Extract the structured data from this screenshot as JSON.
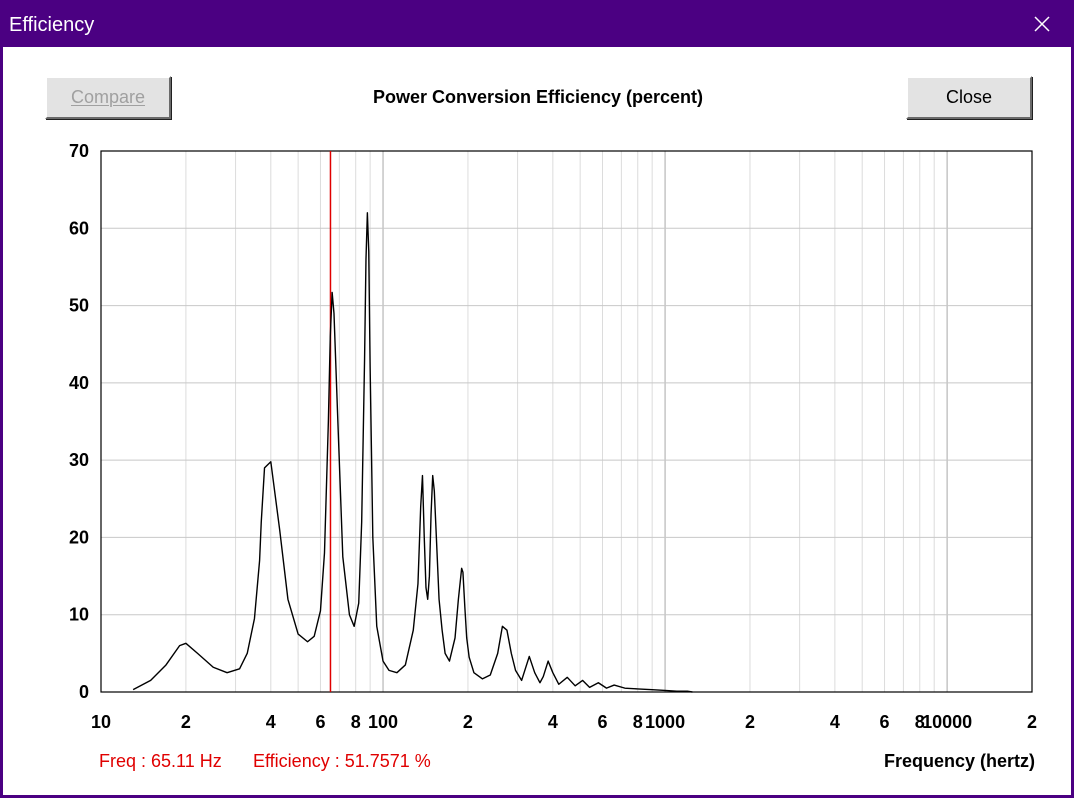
{
  "window": {
    "title": "Efficiency",
    "close_icon": "close-icon"
  },
  "toolbar": {
    "compare_label": "Compare",
    "close_label": "Close"
  },
  "readouts": {
    "freq": "Freq : 65.11 Hz",
    "efficiency": "Efficiency : 51.7571 %"
  },
  "colors": {
    "titlebar": "#4b0082",
    "curve": "#000000",
    "cursor": "#e00000",
    "grid": "#c8c8c8"
  },
  "chart_data": {
    "type": "line",
    "title": "Power Conversion Efficiency (percent)",
    "xlabel": "Frequency (hertz)",
    "ylabel": "",
    "x_scale": "log",
    "xlim": [
      10,
      20000
    ],
    "ylim": [
      0,
      70
    ],
    "grid": true,
    "x_tick_labels": [
      "10",
      "2",
      "4",
      "6",
      "8",
      "100",
      "2",
      "4",
      "6",
      "8",
      "1000",
      "2",
      "4",
      "6",
      "8",
      "10000",
      "2"
    ],
    "x_tick_values": [
      10,
      20,
      40,
      60,
      80,
      100,
      200,
      400,
      600,
      800,
      1000,
      2000,
      4000,
      6000,
      8000,
      10000,
      20000
    ],
    "y_tick_labels": [
      "0",
      "10",
      "20",
      "30",
      "40",
      "50",
      "60",
      "70"
    ],
    "y_tick_values": [
      0,
      10,
      20,
      30,
      40,
      50,
      60,
      70
    ],
    "cursor_x": 65.11,
    "series": [
      {
        "x": [
          13,
          15,
          17,
          19,
          20,
          22,
          25,
          28,
          31,
          33,
          35,
          36.5,
          37,
          38,
          40,
          43,
          46,
          50,
          54,
          57,
          60,
          62,
          64,
          65,
          66,
          67,
          69,
          72,
          76,
          79,
          82,
          84,
          86,
          87,
          88,
          89,
          90,
          92,
          95,
          100,
          105,
          112,
          120,
          128,
          133,
          136,
          138,
          140,
          142,
          144,
          146,
          148,
          150,
          152,
          155,
          158,
          162,
          166,
          172,
          180,
          185,
          190,
          192,
          195,
          198,
          202,
          210,
          225,
          240,
          255,
          265,
          275,
          285,
          295,
          310,
          330,
          345,
          360,
          370,
          385,
          400,
          420,
          450,
          480,
          510,
          540,
          580,
          620,
          660,
          720,
          800,
          900,
          1000,
          1100,
          1200,
          1250
        ],
        "y": [
          0.3,
          1.5,
          3.5,
          6.0,
          6.3,
          5.0,
          3.2,
          2.5,
          3.0,
          5.0,
          9.5,
          17.0,
          22.0,
          29.0,
          29.8,
          21.0,
          12.0,
          7.5,
          6.5,
          7.2,
          10.5,
          18.0,
          35.0,
          46.0,
          51.7,
          49.0,
          36.0,
          17.5,
          10.0,
          8.5,
          11.5,
          22.0,
          43.0,
          56.0,
          62.0,
          57.0,
          42.0,
          20.0,
          8.5,
          4.0,
          2.8,
          2.5,
          3.5,
          8.0,
          14.0,
          24.0,
          28.0,
          20.0,
          13.5,
          12.0,
          15.0,
          23.0,
          28.0,
          26.0,
          19.0,
          12.0,
          8.0,
          5.0,
          4.0,
          7.0,
          12.0,
          16.0,
          15.5,
          11.0,
          7.0,
          4.5,
          2.5,
          1.7,
          2.2,
          5.0,
          8.5,
          8.0,
          5.0,
          2.8,
          1.5,
          4.6,
          2.5,
          1.2,
          2.0,
          4.0,
          2.5,
          1.0,
          1.9,
          0.8,
          1.5,
          0.6,
          1.2,
          0.5,
          0.9,
          0.5,
          0.4,
          0.3,
          0.2,
          0.1,
          0.1,
          0.0
        ]
      }
    ]
  }
}
